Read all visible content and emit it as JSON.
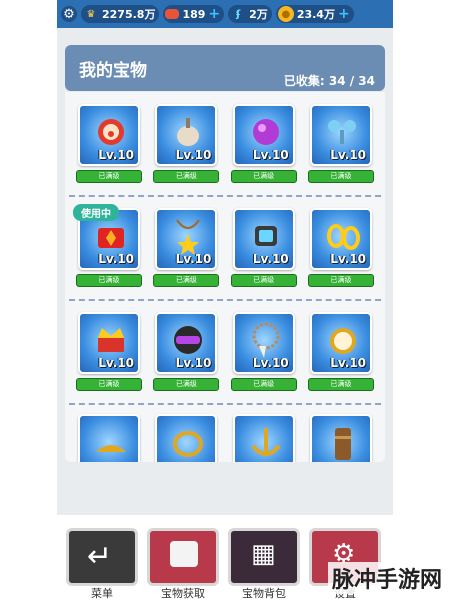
{
  "topbar": {
    "crown_value": "2275.8万",
    "energy_value": "189",
    "key_value": "2万",
    "coin_value": "23.4万"
  },
  "header": {
    "title": "我的宝物",
    "collected": "已收集: 34 / 34"
  },
  "rows": [
    [
      {
        "level": "Lv.10",
        "status": "已满级"
      },
      {
        "level": "Lv.10",
        "status": "已满级"
      },
      {
        "level": "Lv.10",
        "status": "已满级"
      },
      {
        "level": "Lv.10",
        "status": "已满级"
      }
    ],
    [
      {
        "level": "Lv.10",
        "status": "已满级",
        "tag": "使用中"
      },
      {
        "level": "Lv.10",
        "status": "已满级"
      },
      {
        "level": "Lv.10",
        "status": "已满级"
      },
      {
        "level": "Lv.10",
        "status": "已满级"
      }
    ],
    [
      {
        "level": "Lv.10",
        "status": "已满级"
      },
      {
        "level": "Lv.10",
        "status": "已满级"
      },
      {
        "level": "Lv.10",
        "status": "已满级"
      },
      {
        "level": "Lv.10",
        "status": "已满级"
      }
    ]
  ],
  "bottom": {
    "menu": "菜单",
    "treasure_get": "宝物获取",
    "treasure_bag": "宝物背包",
    "settings": "设置"
  },
  "watermark": "脉冲手游网",
  "colors": {
    "accent": "#2c6fb3",
    "status_green": "#36b336",
    "card_blue": "#3a8de0"
  }
}
